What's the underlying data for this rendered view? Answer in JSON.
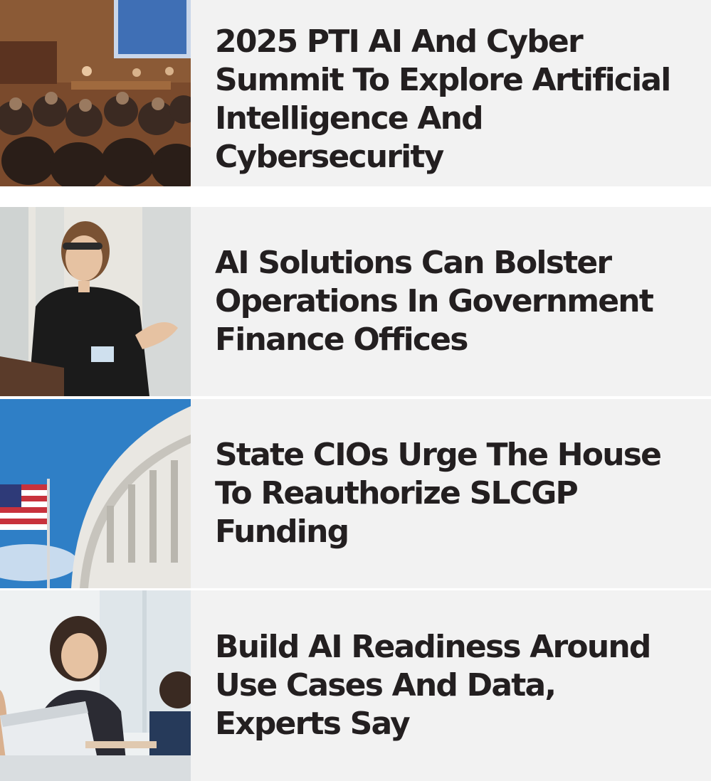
{
  "articles": [
    {
      "title": "2025 PTI AI And Cyber Summit To Explore Artificial Intelligence And Cybersecurity",
      "thumbnail": "conference-audience-photo"
    },
    {
      "title": "AI Solutions Can Bolster Operations In Government Finance Offices",
      "thumbnail": "speaker-woman-presenting-photo"
    },
    {
      "title": "State CIOs Urge The House To Reauthorize SLCGP Funding",
      "thumbnail": "capitol-dome-flag-photo"
    },
    {
      "title": "Build AI Readiness Around Use Cases And Data, Experts Say",
      "thumbnail": "office-meeting-laptop-photo"
    }
  ],
  "colors": {
    "background": "#f2f2f2",
    "separator": "#ffffff",
    "headline": "#231f20"
  }
}
